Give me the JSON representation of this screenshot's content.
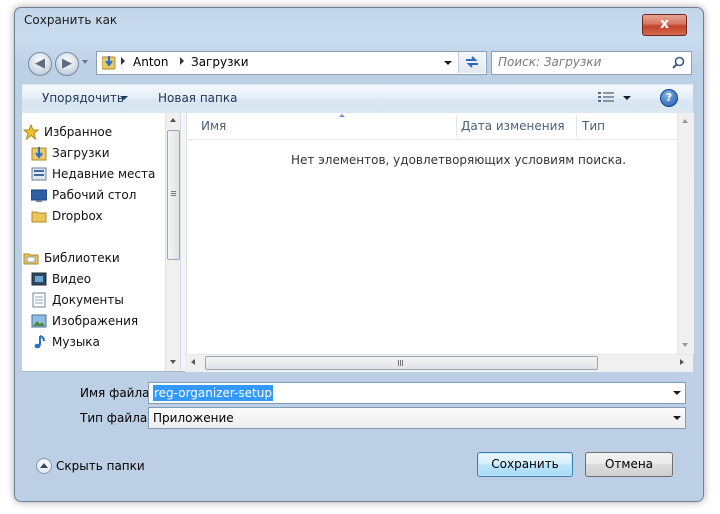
{
  "window": {
    "title": "Сохранить как",
    "close_label": "x"
  },
  "nav": {
    "path": [
      "Anton",
      "Загрузки"
    ],
    "search_placeholder": "Поиск: Загрузки"
  },
  "toolbar": {
    "organize": "Упорядочить",
    "new_folder": "Новая папка"
  },
  "sidebar": {
    "favorites": {
      "label": "Избранное",
      "items": [
        "Загрузки",
        "Недавние места",
        "Рабочий стол",
        "Dropbox"
      ]
    },
    "libraries": {
      "label": "Библиотеки",
      "items": [
        "Видео",
        "Документы",
        "Изображения",
        "Музыка"
      ]
    }
  },
  "list": {
    "columns": [
      "Имя",
      "Дата изменения",
      "Тип"
    ],
    "empty_message": "Нет элементов, удовлетворяющих условиям поиска."
  },
  "form": {
    "filename_label": "Имя файла:",
    "filename_value": "reg-organizer-setup",
    "filetype_label": "Тип файла:",
    "filetype_value": "Приложение"
  },
  "footer": {
    "hide_folders": "Скрыть папки",
    "save": "Сохранить",
    "cancel": "Отмена"
  },
  "colors": {
    "accent_blue": "#1e5aa0",
    "selection": "#3399ff",
    "close_red": "#c1422a"
  }
}
